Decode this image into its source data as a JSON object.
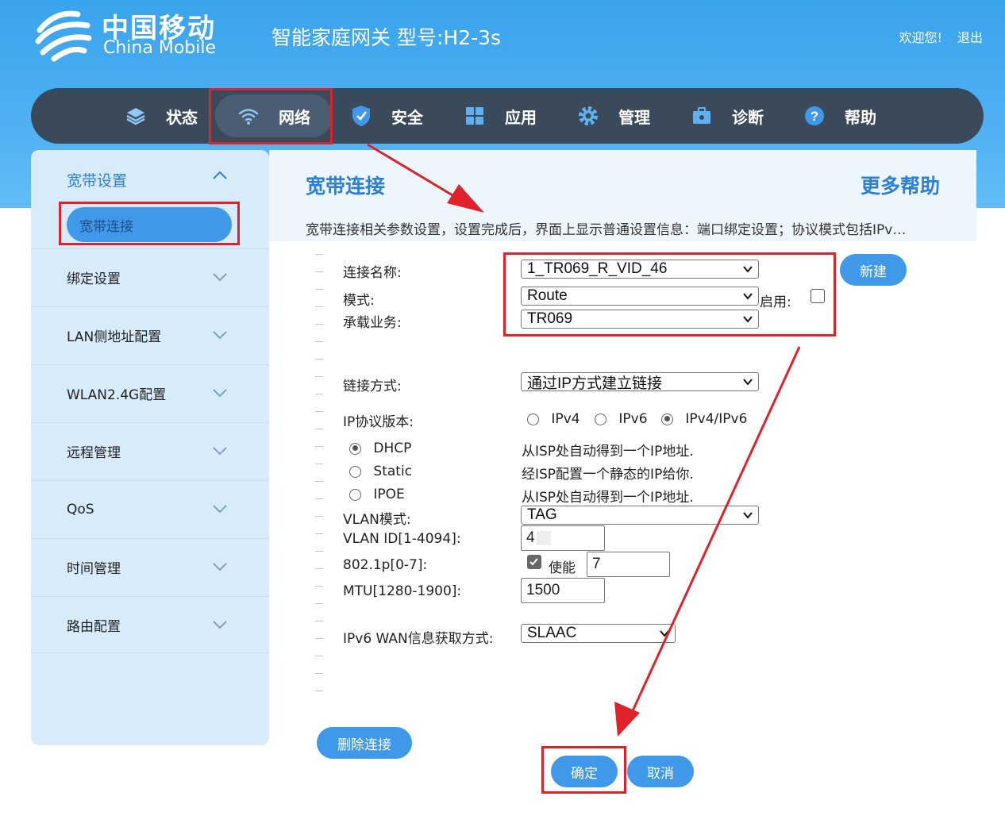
{
  "header": {
    "brand_cn": "中国移动",
    "brand_en": "China Mobile",
    "model": "智能家庭网关 型号:H2-3s",
    "welcome": "欢迎您!",
    "logout": "退出"
  },
  "nav": [
    {
      "label": "状态",
      "icon": "layers-icon"
    },
    {
      "label": "网络",
      "icon": "wifi-icon"
    },
    {
      "label": "安全",
      "icon": "shield-icon"
    },
    {
      "label": "应用",
      "icon": "grid-icon"
    },
    {
      "label": "管理",
      "icon": "gear-icon"
    },
    {
      "label": "诊断",
      "icon": "toolbox-icon"
    },
    {
      "label": "帮助",
      "icon": "help-icon"
    }
  ],
  "sidebar": {
    "group": "宽带设置",
    "active": "宽带连接",
    "items": [
      "绑定设置",
      "LAN侧地址配置",
      "WLAN2.4G配置",
      "远程管理",
      "QoS",
      "时间管理",
      "路由配置"
    ]
  },
  "content": {
    "title": "宽带连接",
    "more_help": "更多帮助",
    "description": "宽带连接相关参数设置，设置完成后，界面上显示普通设置信息：端口绑定设置；协议模式包括IPv…"
  },
  "form": {
    "conn_name_label": "连接名称:",
    "conn_name_value": "1_TR069_R_VID_46",
    "new_button": "新建",
    "mode_label": "模式:",
    "mode_value": "Route",
    "enable_label": "启用:",
    "service_label": "承载业务:",
    "service_value": "TR069",
    "link_label": "链接方式:",
    "link_value": "通过IP方式建立链接",
    "ip_version_label": "IP协议版本:",
    "ipv4": "IPv4",
    "ipv6": "IPv6",
    "ipv4v6": "IPv4/IPv6",
    "dhcp": "DHCP",
    "dhcp_desc": "从ISP处自动得到一个IP地址.",
    "static": "Static",
    "static_desc": "经ISP配置一个静态的IP给你.",
    "ipoe": "IPOE",
    "ipoe_desc": "从ISP处自动得到一个IP地址.",
    "vlan_mode_label": "VLAN模式:",
    "vlan_mode_value": "TAG",
    "vlan_id_label": "VLAN ID[1-4094]:",
    "vlan_id_value": "4",
    "p8021_label": "802.1p[0-7]:",
    "p8021_enable": "使能",
    "p8021_value": "7",
    "mtu_label": "MTU[1280-1900]:",
    "mtu_value": "1500",
    "ipv6wan_label": "IPv6 WAN信息获取方式:",
    "ipv6wan_value": "SLAAC",
    "delete_button": "删除连接",
    "ok_button": "确定",
    "cancel_button": "取消"
  },
  "colors": {
    "accent": "#3f98e8",
    "nav": "#3b4a5b",
    "annotation": "#e0222a"
  }
}
